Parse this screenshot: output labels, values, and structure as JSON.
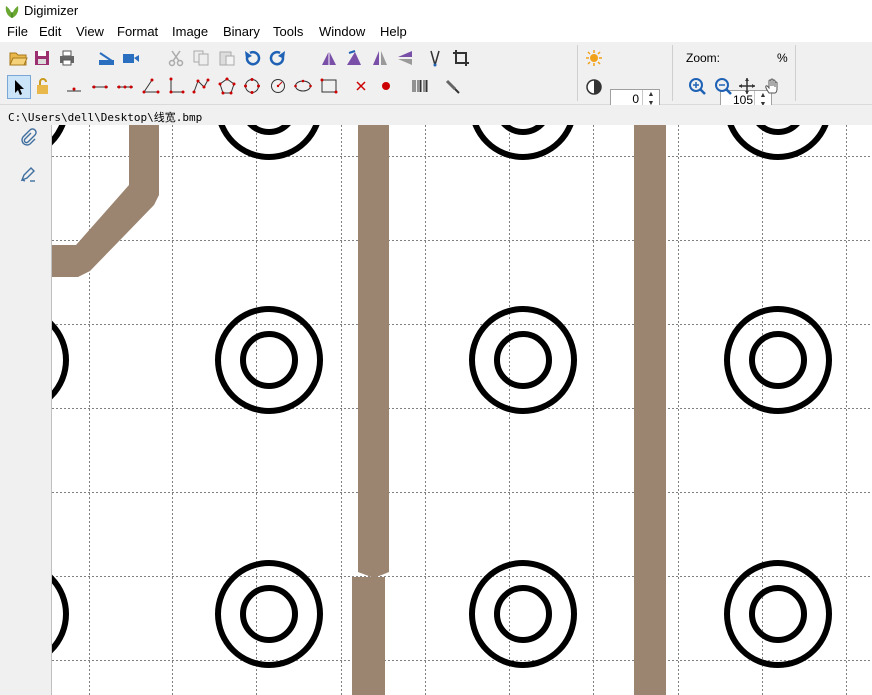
{
  "window": {
    "title": "Digimizer"
  },
  "menu": [
    "File",
    "Edit",
    "View",
    "Format",
    "Image",
    "Binary",
    "Tools",
    "Window",
    "Help"
  ],
  "toolbar": {
    "row1_icons": [
      "open-folder-icon",
      "save-icon",
      "print-icon",
      "scanner-icon",
      "camera-icon",
      "cut-icon",
      "copy-icon",
      "paste-icon",
      "undo-icon",
      "redo-icon",
      "rotate-left-icon",
      "rotate-right-icon",
      "flip-horizontal-icon",
      "flip-vertical-icon",
      "deskew-icon",
      "crop-icon"
    ],
    "row2_icons": [
      "select-arrow-icon",
      "lock-icon",
      "marker-icon",
      "line-icon",
      "segmented-line-icon",
      "angle-icon",
      "perpendicular-icon",
      "polyline-icon",
      "polygon-icon",
      "closed-curve-icon",
      "circle-icon",
      "ellipse-icon",
      "rectangle-icon",
      "delete-icon",
      "dot-icon",
      "barcode-icon",
      "brush-icon"
    ],
    "brightness": "0",
    "contrast": "0",
    "line_width": "5",
    "draw_color": "#ffff00",
    "zoom_label": "Zoom:",
    "zoom_value": "105",
    "zoom_unit": "%"
  },
  "path": "C:\\Users\\dell\\Desktop\\线宽.bmp",
  "sidebar": [
    "paperclip-icon",
    "pen-edit-icon"
  ],
  "colors": {
    "trace": "#9c8570",
    "ring": "#000000",
    "grid": "#808080"
  }
}
